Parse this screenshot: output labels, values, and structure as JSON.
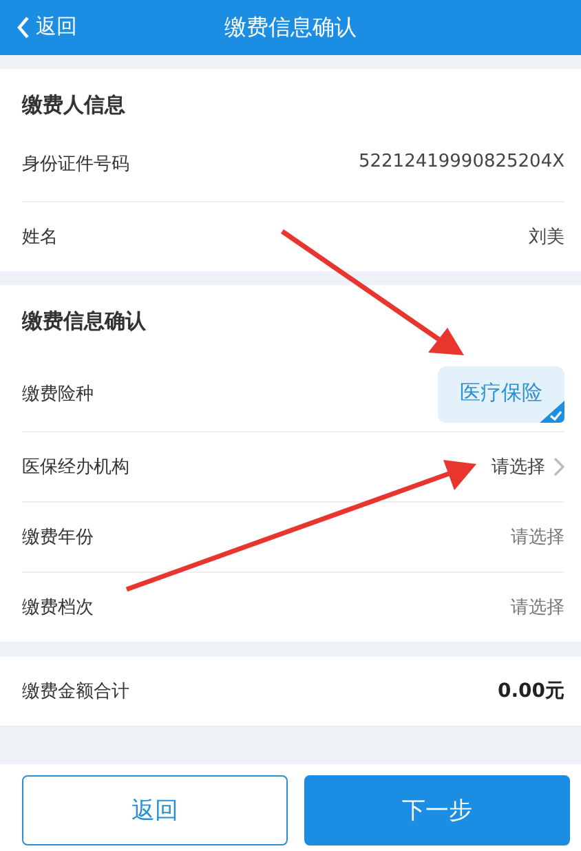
{
  "header": {
    "back": "返回",
    "title": "缴费信息确认"
  },
  "payer": {
    "title": "缴费人信息",
    "rows": [
      {
        "label": "身份证件号码",
        "value": "52212419990825204X"
      },
      {
        "label": "姓名",
        "value": "刘美"
      }
    ]
  },
  "payment": {
    "title": "缴费信息确认",
    "rows": [
      {
        "kind": "chip",
        "label": "缴费险种",
        "value": "医疗保险",
        "selected": true
      },
      {
        "kind": "select",
        "label": "医保经办机构",
        "placeholder": "请选择",
        "chevron": true
      },
      {
        "kind": "select",
        "label": "缴费年份",
        "placeholder": "请选择",
        "chevron": false
      },
      {
        "kind": "select",
        "label": "缴费档次",
        "placeholder": "请选择",
        "chevron": false
      }
    ]
  },
  "total": {
    "label": "缴费金额合计",
    "value": "0.00元"
  },
  "buttons": [
    {
      "kind": "outline",
      "label": "返回"
    },
    {
      "kind": "primary",
      "label": "下一步"
    }
  ]
}
